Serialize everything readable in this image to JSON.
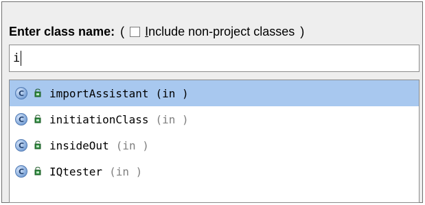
{
  "dialog": {
    "title": "Enter class name:",
    "open_paren": "(",
    "checkbox_label_hotkey": "I",
    "checkbox_label_rest": "nclude non-project classes",
    "close_paren": ")",
    "include_non_project_checked": false
  },
  "search": {
    "value": "i"
  },
  "results": [
    {
      "name": "importAssistant",
      "location": "(in )",
      "selected": true,
      "icon": "class-icon"
    },
    {
      "name": "initiationClass",
      "location": "(in )",
      "selected": false,
      "icon": "class-icon"
    },
    {
      "name": "insideOut",
      "location": "(in )",
      "selected": false,
      "icon": "class-icon"
    },
    {
      "name": "IQtester",
      "location": "(in )",
      "selected": false,
      "icon": "class-icon"
    }
  ],
  "colors": {
    "selection": "#a8c8ef",
    "location_text": "#7f7f7f"
  }
}
